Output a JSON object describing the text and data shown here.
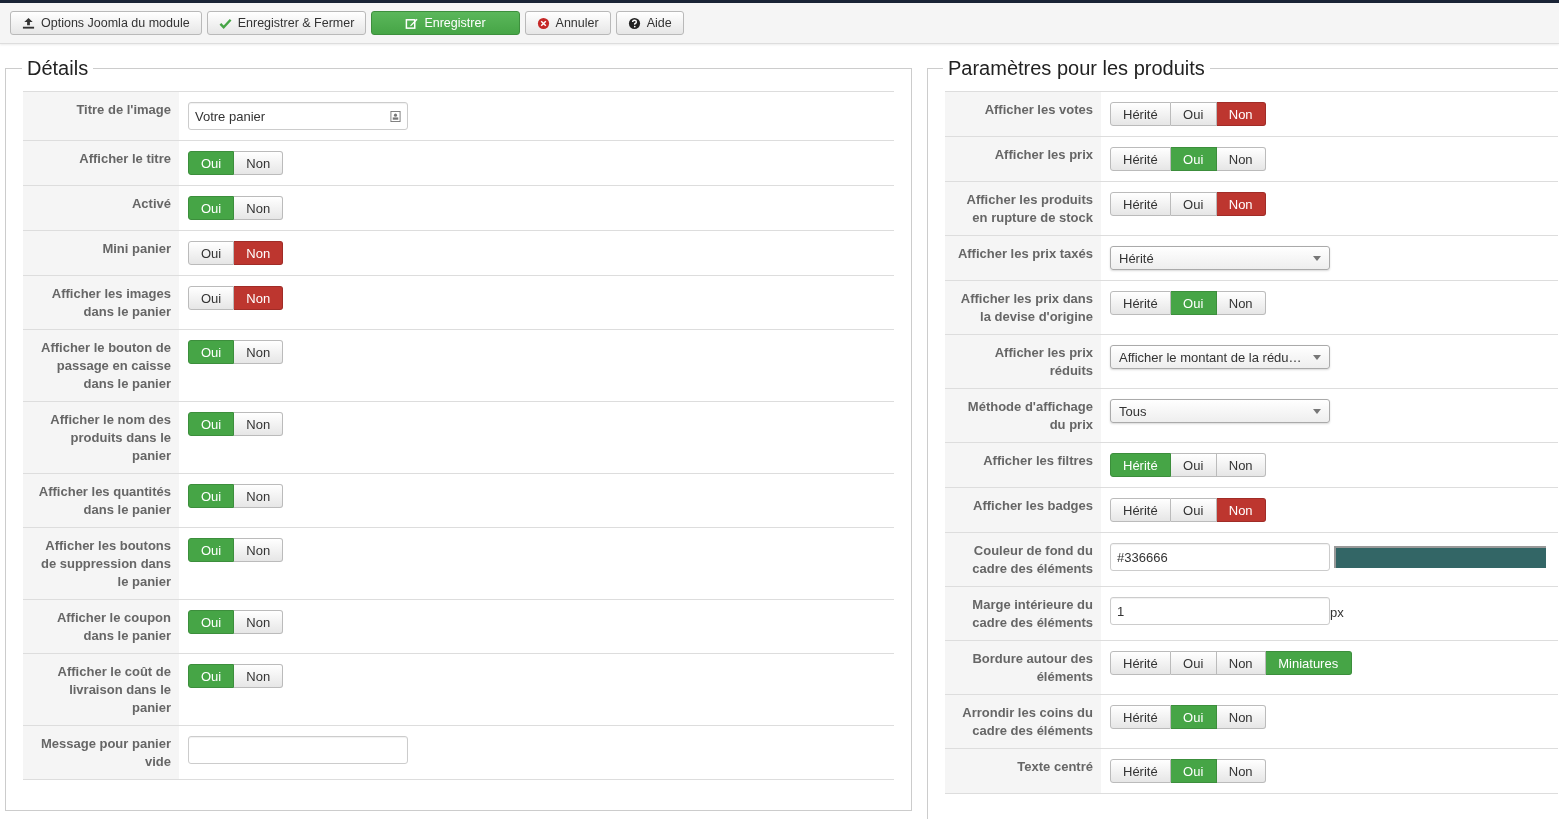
{
  "toolbar": [
    {
      "label": "Options Joomla du module",
      "kind": "options",
      "primary": false
    },
    {
      "label": "Enregistrer & Fermer",
      "kind": "save-close",
      "primary": false
    },
    {
      "label": "Enregistrer",
      "kind": "save",
      "primary": true
    },
    {
      "label": "Annuler",
      "kind": "cancel",
      "primary": false
    },
    {
      "label": "Aide",
      "kind": "help",
      "primary": false
    }
  ],
  "panels": [
    {
      "title": "Détails",
      "rows": [
        {
          "label": "Titre de l'image",
          "kind": "text",
          "value": "Votre panier",
          "addon": true
        },
        {
          "label": "Afficher le titre",
          "kind": "toggle",
          "options": [
            {
              "label": "Oui",
              "kind": "yes",
              "selected": true
            },
            {
              "label": "Non",
              "kind": "no",
              "selected": false
            }
          ]
        },
        {
          "label": "Activé",
          "kind": "toggle",
          "options": [
            {
              "label": "Oui",
              "kind": "yes",
              "selected": true
            },
            {
              "label": "Non",
              "kind": "no",
              "selected": false
            }
          ]
        },
        {
          "label": "Mini panier",
          "kind": "toggle",
          "options": [
            {
              "label": "Oui",
              "kind": "yes",
              "selected": false
            },
            {
              "label": "Non",
              "kind": "no",
              "selected": true
            }
          ]
        },
        {
          "label": "Afficher les images dans le panier",
          "kind": "toggle",
          "options": [
            {
              "label": "Oui",
              "kind": "yes",
              "selected": false
            },
            {
              "label": "Non",
              "kind": "no",
              "selected": true
            }
          ]
        },
        {
          "label": "Afficher le bouton de passage en caisse dans le panier",
          "kind": "toggle",
          "options": [
            {
              "label": "Oui",
              "kind": "yes",
              "selected": true
            },
            {
              "label": "Non",
              "kind": "no",
              "selected": false
            }
          ]
        },
        {
          "label": "Afficher le nom des produits dans le panier",
          "kind": "toggle",
          "options": [
            {
              "label": "Oui",
              "kind": "yes",
              "selected": true
            },
            {
              "label": "Non",
              "kind": "no",
              "selected": false
            }
          ]
        },
        {
          "label": "Afficher les quantités dans le panier",
          "kind": "toggle",
          "options": [
            {
              "label": "Oui",
              "kind": "yes",
              "selected": true
            },
            {
              "label": "Non",
              "kind": "no",
              "selected": false
            }
          ]
        },
        {
          "label": "Afficher les boutons de suppression dans le panier",
          "kind": "toggle",
          "options": [
            {
              "label": "Oui",
              "kind": "yes",
              "selected": true
            },
            {
              "label": "Non",
              "kind": "no",
              "selected": false
            }
          ]
        },
        {
          "label": "Afficher le coupon dans le panier",
          "kind": "toggle",
          "options": [
            {
              "label": "Oui",
              "kind": "yes",
              "selected": true
            },
            {
              "label": "Non",
              "kind": "no",
              "selected": false
            }
          ]
        },
        {
          "label": "Afficher le coût de livraison dans le panier",
          "kind": "toggle",
          "options": [
            {
              "label": "Oui",
              "kind": "yes",
              "selected": true
            },
            {
              "label": "Non",
              "kind": "no",
              "selected": false
            }
          ]
        },
        {
          "label": "Message pour panier vide",
          "kind": "text",
          "addon": false
        }
      ]
    },
    {
      "title": "Paramètres pour les produits",
      "rows": [
        {
          "label": "Afficher les votes",
          "kind": "toggle",
          "options": [
            {
              "label": "Hérité",
              "kind": "inherit",
              "selected": false
            },
            {
              "label": "Oui",
              "kind": "yes",
              "selected": false
            },
            {
              "label": "Non",
              "kind": "no",
              "selected": true
            }
          ]
        },
        {
          "label": "Afficher les prix",
          "kind": "toggle",
          "options": [
            {
              "label": "Hérité",
              "kind": "inherit",
              "selected": false
            },
            {
              "label": "Oui",
              "kind": "yes",
              "selected": true
            },
            {
              "label": "Non",
              "kind": "no",
              "selected": false
            }
          ]
        },
        {
          "label": "Afficher les produits en rupture de stock",
          "kind": "toggle",
          "options": [
            {
              "label": "Hérité",
              "kind": "inherit",
              "selected": false
            },
            {
              "label": "Oui",
              "kind": "yes",
              "selected": false
            },
            {
              "label": "Non",
              "kind": "no",
              "selected": true
            }
          ]
        },
        {
          "label": "Afficher les prix taxés",
          "kind": "select",
          "value": "Hérité"
        },
        {
          "label": "Afficher les prix dans la devise d'origine",
          "kind": "toggle",
          "options": [
            {
              "label": "Hérité",
              "kind": "inherit",
              "selected": false
            },
            {
              "label": "Oui",
              "kind": "yes",
              "selected": true
            },
            {
              "label": "Non",
              "kind": "no",
              "selected": false
            }
          ]
        },
        {
          "label": "Afficher les prix réduits",
          "kind": "select",
          "value": "Afficher le montant de la rédu…"
        },
        {
          "label": "Méthode d'affichage du prix",
          "kind": "select",
          "value": "Tous"
        },
        {
          "label": "Afficher les filtres",
          "kind": "toggle",
          "options": [
            {
              "label": "Hérité",
              "kind": "inherit",
              "selected": true
            },
            {
              "label": "Oui",
              "kind": "yes",
              "selected": false
            },
            {
              "label": "Non",
              "kind": "no",
              "selected": false
            }
          ]
        },
        {
          "label": "Afficher les badges",
          "kind": "toggle",
          "options": [
            {
              "label": "Hérité",
              "kind": "inherit",
              "selected": false
            },
            {
              "label": "Oui",
              "kind": "yes",
              "selected": false
            },
            {
              "label": "Non",
              "kind": "no",
              "selected": true
            }
          ]
        },
        {
          "label": "Couleur de fond du cadre des éléments",
          "kind": "color",
          "value": "#336666"
        },
        {
          "label": "Marge intérieure du cadre des éléments",
          "kind": "number",
          "value": "1",
          "unit": "px"
        },
        {
          "label": "Bordure autour des éléments",
          "kind": "toggle",
          "options": [
            {
              "label": "Hérité",
              "kind": "inherit",
              "selected": false
            },
            {
              "label": "Oui",
              "kind": "yes",
              "selected": false
            },
            {
              "label": "Non",
              "kind": "no",
              "selected": false
            },
            {
              "label": "Miniatures",
              "kind": "other",
              "selected": true
            }
          ]
        },
        {
          "label": "Arrondir les coins du cadre des éléments",
          "kind": "toggle",
          "options": [
            {
              "label": "Hérité",
              "kind": "inherit",
              "selected": false
            },
            {
              "label": "Oui",
              "kind": "yes",
              "selected": true
            },
            {
              "label": "Non",
              "kind": "no",
              "selected": false
            }
          ]
        },
        {
          "label": "Texte centré",
          "kind": "toggle",
          "options": [
            {
              "label": "Hérité",
              "kind": "inherit",
              "selected": false
            },
            {
              "label": "Oui",
              "kind": "yes",
              "selected": true
            },
            {
              "label": "Non",
              "kind": "no",
              "selected": false
            }
          ]
        }
      ]
    }
  ]
}
